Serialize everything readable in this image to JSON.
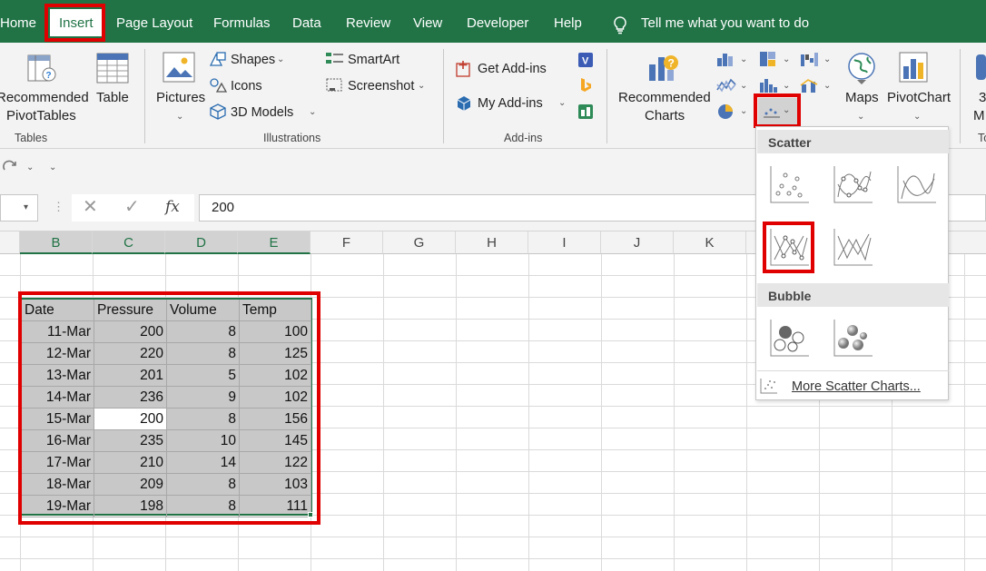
{
  "tabs": [
    "Home",
    "Insert",
    "Page Layout",
    "Formulas",
    "Data",
    "Review",
    "View",
    "Developer",
    "Help"
  ],
  "tell_me": "Tell me what you want to do",
  "ribbon": {
    "tables": {
      "recommended_line1": "Recommended",
      "recommended_line2": "PivotTables",
      "table": "Table",
      "group": "Tables"
    },
    "illustrations": {
      "pictures": "Pictures",
      "shapes": "Shapes",
      "icons": "Icons",
      "models": "3D Models",
      "smartart": "SmartArt",
      "screenshot": "Screenshot",
      "group": "Illustrations"
    },
    "addins": {
      "get": "Get Add-ins",
      "my": "My Add-ins",
      "group": "Add-ins"
    },
    "charts": {
      "recommended_line1": "Recommended",
      "recommended_line2": "Charts",
      "maps": "Maps",
      "pivotchart": "PivotChart",
      "partial1": "3",
      "partial2": "M",
      "partial_group": "To"
    }
  },
  "formula": {
    "name_box": "",
    "fx": "fx",
    "value": "200"
  },
  "columns": [
    "B",
    "C",
    "D",
    "E",
    "F",
    "G",
    "H",
    "I",
    "J",
    "K"
  ],
  "table": {
    "headers": [
      "Date",
      "Pressure",
      "Volume",
      "Temp"
    ],
    "rows": [
      [
        "11-Mar",
        "200",
        "8",
        "100"
      ],
      [
        "12-Mar",
        "220",
        "8",
        "125"
      ],
      [
        "13-Mar",
        "201",
        "5",
        "102"
      ],
      [
        "14-Mar",
        "236",
        "9",
        "102"
      ],
      [
        "15-Mar",
        "200",
        "8",
        "156"
      ],
      [
        "16-Mar",
        "235",
        "10",
        "145"
      ],
      [
        "17-Mar",
        "210",
        "14",
        "122"
      ],
      [
        "18-Mar",
        "209",
        "8",
        "103"
      ],
      [
        "19-Mar",
        "198",
        "8",
        "111"
      ]
    ]
  },
  "menu": {
    "scatter_header": "Scatter",
    "bubble_header": "Bubble",
    "more": "More Scatter Charts..."
  },
  "colors": {
    "excel_green": "#217346",
    "highlight_red": "#e00000",
    "selection_gray": "#c8c8c8"
  }
}
